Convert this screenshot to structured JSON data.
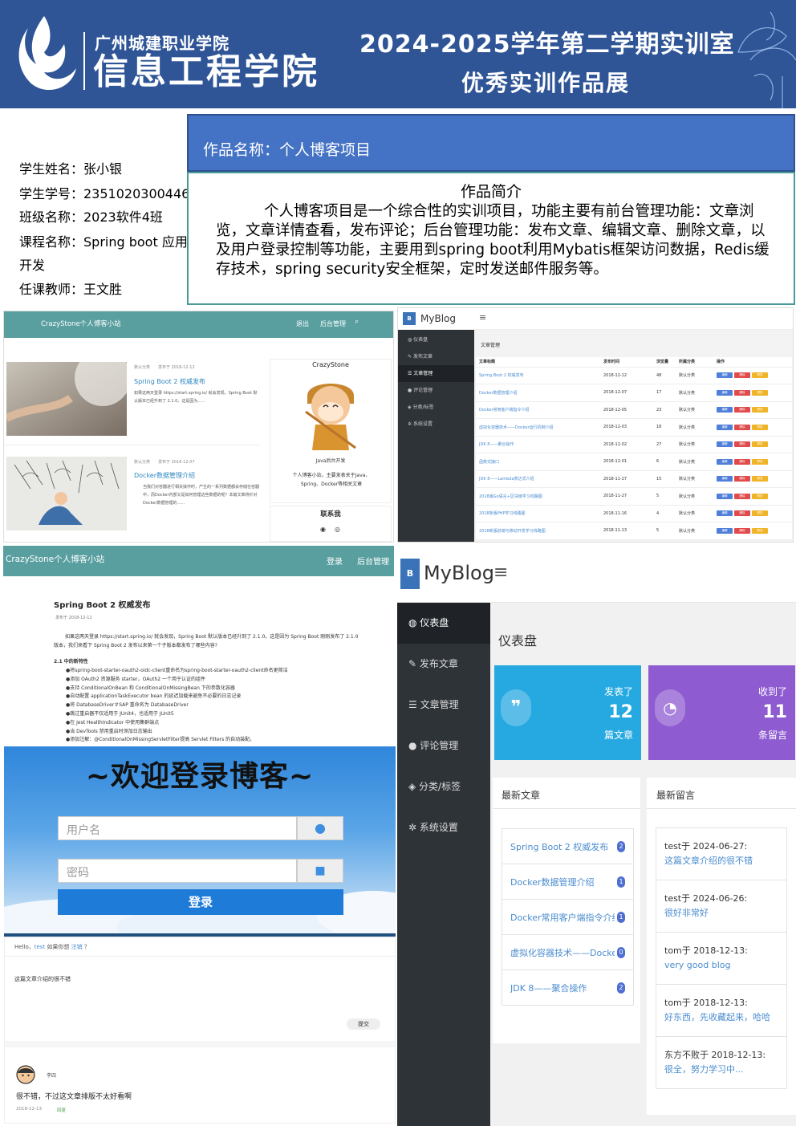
{
  "banner": {
    "school": "广州城建职业学院",
    "college": "信息工程学院",
    "title_line1": "2024-2025学年第二学期实训室",
    "title_line2": "优秀实训作品展",
    "colors": {
      "banner": "#2f5597"
    }
  },
  "student": {
    "name": "学生姓名：张小银",
    "id": "学生学号：2351020300446",
    "class": "班级名称：2023软件4班",
    "course1": "课程名称：Spring boot 应用",
    "course2": "开发",
    "teacher": "任课教师：王文胜"
  },
  "work": {
    "title": "作品名称：个人博客项目",
    "intro_head": "作品简介",
    "intro": "个人博客项目是一个综合性的实训项目，功能主要有前台管理功能：文章浏览，文章详情查看，发布评论；后台管理功能：发布文章、编辑文章、删除文章，以及用户登录控制等功能，主要用到spring boot利用Mybatis框架访问数据，Redis缓存技术，spring security安全框架，定时发送邮件服务等。"
  },
  "home": {
    "site": "CrazyStone个人博客小站",
    "nav_logout": "退出",
    "nav_admin": "后台管理",
    "posts": [
      {
        "meta": "默认分类　　发布于 2018-12-12",
        "title": "Spring Boot 2 权威发布",
        "excerpt": "如果这两天登录 https://start.spring.io/ 就会发现，Spring Boot 默认版本已经升到了 2.1.0。这是因为......"
      },
      {
        "meta": "默认分类　　发布于 2018-12-07",
        "title": "Docker数据管理介绍",
        "excerpt": "当我们对容器进行相关操作时，产生的一系列数据都会存储在容器中，而Docker内部又是如何管理这些数据的呢？本篇文章将针对Docker数据管理的......"
      }
    ],
    "side_name": "CrazyStone",
    "side_sub": "Java后台开发",
    "side_desc": "个人博客小站，主要发表关于Java、Spring、Docker等相关文章",
    "contact": "联系我"
  },
  "admin_list": {
    "brand": "MyBlog",
    "menu": [
      "仪表盘",
      "发布文章",
      "文章管理",
      "评论管理",
      "分类/标签",
      "系统设置"
    ],
    "active": 2,
    "page_title": "文章管理",
    "headers": [
      "文章标题",
      "发布时间",
      "浏览量",
      "所属分类",
      "操作"
    ],
    "rows": [
      [
        "Spring Boot 2 权威发布",
        "2018-12-12",
        "48",
        "默认分类"
      ],
      [
        "Docker数据管理介绍",
        "2018-12-07",
        "17",
        "默认分类"
      ],
      [
        "Docker常用客户端指令介绍",
        "2018-12-05",
        "23",
        "默认分类"
      ],
      [
        "虚拟化容器技术——Docker运行机制介绍",
        "2018-12-03",
        "18",
        "默认分类"
      ],
      [
        "JDK 8——聚合操作",
        "2018-12-02",
        "27",
        "默认分类"
      ],
      [
        "函数式接口",
        "2018-12-01",
        "6",
        "默认分类"
      ],
      [
        "JDK 8——Lambda表达式介绍",
        "2018-11-27",
        "15",
        "默认分类"
      ],
      [
        "2018版Go语言+区块链学习线路图",
        "2018-11-27",
        "5",
        "默认分类"
      ],
      [
        "2018新版PHP学习线路图",
        "2018-11-16",
        "4",
        "默认分类"
      ],
      [
        "2018新版前端与移动开发学习线路图",
        "2018-11-13",
        "5",
        "默认分类"
      ]
    ],
    "btns": [
      "编辑",
      "删除",
      "预览"
    ]
  },
  "article": {
    "site": "CrazyStone个人博客小站",
    "nav_login": "登录",
    "nav_admin": "后台管理",
    "title": "Spring Boot 2 权威发布",
    "date": "发布于 2018-12-12",
    "para": "如果这两天登录 https://start.spring.io/ 就会发现，Spring Boot 默认版本已经升到了 2.1.0。这是因为 Spring Boot 刚刚发布了 2.1.0 版本，我们来看下 Spring Boot 2 发布以来第一个子版本都发布了哪些内容?",
    "section": "2.1 中的新特性",
    "bullets": [
      "●将spring-boot-starter-oauth2-oidc-client重命名为spring-boot-starter-oauth2-client命名更简洁",
      "●添加 OAuth2 资源服务 starter，OAuth2 一个用于认证的组件",
      "●支持 ConditionalOnBean 和 ConditionalOnMissingBean 下的参数化容器",
      "●自动配置 applicationTaskExecutor bean 的延迟加载来避免不必要的日志记录",
      "●将 DatabaseDriver＃SAP 重命名为 DatabaseDriver",
      "●跳过重启器不仅适用于 JUnit4，也适用于 JUnit5",
      "●在 Jest HealthIndicator 中使用集群端点",
      "●当 DevTools 禁用重启时添加日志输出",
      "●添加注解：@ConditionalOnMissingServletFilter提高 Servlet Filters 的自动装配。"
    ]
  },
  "login": {
    "title": "~欢迎登录博客~",
    "user_ph": "用户名",
    "pass_ph": "密码",
    "btn": "登录"
  },
  "comment": {
    "hello": "Hello，",
    "user": "test",
    "ask": "如果你想",
    "logout": "注销",
    "q": "？",
    "text": "这篇文章介绍的很不错",
    "submit": "提交",
    "author": "李四",
    "body": "很不错，不过这文章排版不太好看啊",
    "date": "2018-12-13",
    "reply": "回复"
  },
  "dashboard": {
    "brand": "MyBlog",
    "menu": [
      "仪表盘",
      "发布文章",
      "文章管理",
      "评论管理",
      "分类/标签",
      "系统设置"
    ],
    "page_title": "仪表盘",
    "stat1": {
      "top": "发表了",
      "num": "12",
      "bot": "篇文章",
      "color": "#26a9e0"
    },
    "stat2": {
      "top": "收到了",
      "num": "11",
      "bot": "条留言",
      "color": "#8e5bd1"
    },
    "recent_title": "最新文章",
    "comments_title": "最新留言",
    "recent": [
      {
        "t": "Spring Boot 2 权威发布",
        "n": "2"
      },
      {
        "t": "Docker数据管理介绍",
        "n": "1"
      },
      {
        "t": "Docker常用客户端指令介绍",
        "n": "1"
      },
      {
        "t": "虚拟化容器技术——Docker运行机制介绍",
        "n": "0"
      },
      {
        "t": "JDK 8——聚合操作",
        "n": "2"
      }
    ],
    "msgs": [
      {
        "h": "test于 2024-06-27:",
        "b": "这篇文章介绍的很不错"
      },
      {
        "h": "test于 2024-06-26:",
        "b": "很好非常好"
      },
      {
        "h": "tom于 2018-12-13:",
        "b": "very good blog"
      },
      {
        "h": "tom于 2018-12-13:",
        "b": "好东西，先收藏起来，哈哈"
      },
      {
        "h": "东方不败于 2018-12-13:",
        "b": "很全，努力学习中..."
      }
    ]
  }
}
